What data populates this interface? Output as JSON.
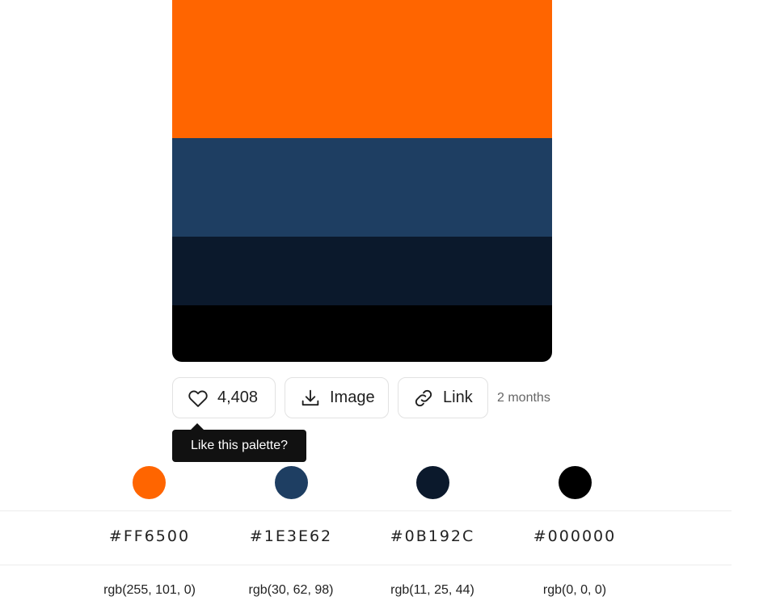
{
  "palette": {
    "colors": [
      "#FF6500",
      "#1E3E62",
      "#0B192C",
      "#000000"
    ]
  },
  "actions": {
    "like_count": "4,408",
    "image_label": "Image",
    "link_label": "Link",
    "time_ago": "2 months"
  },
  "tooltip": {
    "text": "Like this palette?"
  },
  "colors": [
    {
      "hex": "#FF6500",
      "rgb": "rgb(255, 101, 0)",
      "swatch": "#FF6500"
    },
    {
      "hex": "#1E3E62",
      "rgb": "rgb(30, 62, 98)",
      "swatch": "#1E3E62"
    },
    {
      "hex": "#0B192C",
      "rgb": "rgb(11, 25, 44)",
      "swatch": "#0B192C"
    },
    {
      "hex": "#000000",
      "rgb": "rgb(0, 0, 0)",
      "swatch": "#000000"
    }
  ],
  "icons": {
    "like": "heart-icon",
    "image": "download-icon",
    "link": "link-icon"
  }
}
